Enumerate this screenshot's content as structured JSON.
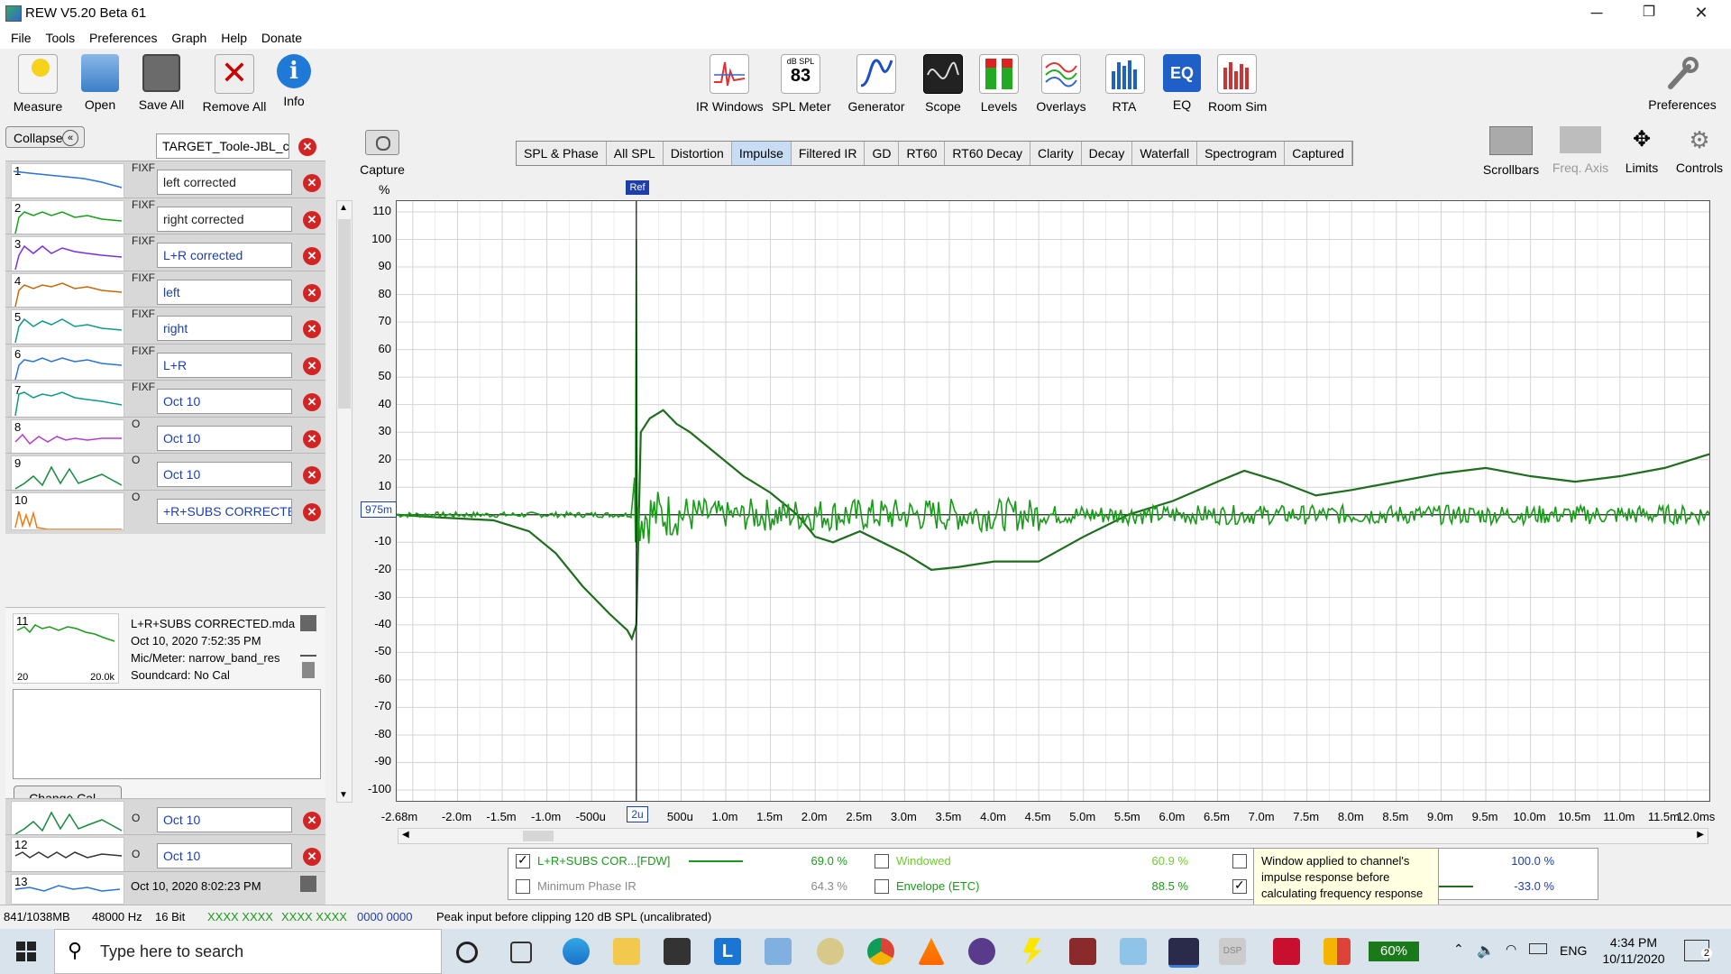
{
  "window": {
    "title": "REW V5.20 Beta 61",
    "min": "─",
    "max": "❐",
    "close": "✕"
  },
  "menu": [
    "File",
    "Tools",
    "Preferences",
    "Graph",
    "Help",
    "Donate"
  ],
  "toolbar_left": [
    {
      "label": "Measure",
      "icon": "microphone-icon"
    },
    {
      "label": "Open",
      "icon": "folder-icon"
    },
    {
      "label": "Save All",
      "icon": "save-icon"
    },
    {
      "label": "Remove All",
      "icon": "remove-icon"
    },
    {
      "label": "Info",
      "icon": "info-icon"
    }
  ],
  "toolbar_center": [
    {
      "label": "IR Windows",
      "icon": "ir-windows-icon"
    },
    {
      "label": "SPL Meter",
      "icon": "spl-meter-icon",
      "badge_top": "dB SPL",
      "badge_value": "83"
    },
    {
      "label": "Generator",
      "icon": "generator-icon"
    },
    {
      "label": "Scope",
      "icon": "scope-icon"
    },
    {
      "label": "Levels",
      "icon": "levels-icon"
    },
    {
      "label": "Overlays",
      "icon": "overlays-icon"
    },
    {
      "label": "RTA",
      "icon": "rta-icon"
    },
    {
      "label": "EQ",
      "icon": "eq-icon"
    },
    {
      "label": "Room Sim",
      "icon": "room-sim-icon"
    }
  ],
  "preferences_label": "Preferences",
  "right_controls": [
    "Scrollbars",
    "Freq. Axis",
    "Limits",
    "Controls"
  ],
  "capture_label": "Capture",
  "collapse_label": "Collapse",
  "top_measurement": "TARGET_Toole-JBL_cu",
  "measurements": [
    {
      "num": "1",
      "name": "left corrected",
      "fixf": "FIXF",
      "color": "#2a72d8"
    },
    {
      "num": "2",
      "name": "right corrected",
      "fixf": "FIXF",
      "color": "#11a11a"
    },
    {
      "num": "3",
      "name": "L+R corrected",
      "fixf": "FIXF",
      "color": "#7a2ee0"
    },
    {
      "num": "4",
      "name": "left",
      "fixf": "FIXF",
      "color": "#c26a0a"
    },
    {
      "num": "5",
      "name": "right",
      "fixf": "FIXF",
      "color": "#0d9a8a"
    },
    {
      "num": "6",
      "name": "L+R",
      "fixf": "FIXF",
      "color": "#2a72d8"
    },
    {
      "num": "7",
      "name": "Oct 10",
      "fixf": "FIXF",
      "color": "#0d9a8a"
    },
    {
      "num": "8",
      "name": "Oct 10",
      "fixf": "O",
      "color": "#b43ad0"
    },
    {
      "num": "9",
      "name": "Oct 10",
      "fixf": "O",
      "color": "#168a3a"
    },
    {
      "num": "10",
      "name": "+R+SUBS CORRECTED",
      "fixf": "O",
      "color": "#ef7a10"
    }
  ],
  "selected_info": {
    "num": "11",
    "file": "L+R+SUBS CORRECTED.mda",
    "date": "Oct 10, 2020 7:52:35 PM",
    "mic": "Mic/Meter: narrow_band_res",
    "soundcard": "Soundcard: No Cal",
    "f_low": "20",
    "f_high": "20.0k"
  },
  "change_cal": "Change Cal...",
  "measurements_below": [
    {
      "num": "",
      "name": "Oct 10",
      "fixf": "O",
      "color": "#168a3a"
    },
    {
      "num": "12",
      "name": "Oct 10",
      "fixf": "O",
      "color": "#333333"
    }
  ],
  "row13": {
    "num": "13",
    "date": "Oct 10, 2020 8:02:23 PM"
  },
  "tabs": [
    "SPL & Phase",
    "All SPL",
    "Distortion",
    "Impulse",
    "Filtered IR",
    "GD",
    "RT60",
    "RT60 Decay",
    "Clarity",
    "Decay",
    "Waterfall",
    "Spectrogram",
    "Captured"
  ],
  "active_tab": "Impulse",
  "cursor": {
    "marker": "Ref",
    "y_readout": "975m",
    "x_readout": "2u"
  },
  "chart_data": {
    "type": "line",
    "ylabel": "%",
    "ylim": [
      -100,
      110
    ],
    "yticks": [
      "110",
      "100",
      "90",
      "80",
      "70",
      "60",
      "50",
      "40",
      "30",
      "20",
      "10",
      "",
      "-10",
      "-20",
      "-30",
      "-40",
      "-50",
      "-60",
      "-70",
      "-80",
      "-90",
      "-100"
    ],
    "xlim": [
      -2.68,
      12.0
    ],
    "xticks": [
      "-2.68m",
      "-2.0m",
      "-1.5m",
      "-1.0m",
      "-500u",
      "",
      "500u",
      "1.0m",
      "1.5m",
      "2.0m",
      "2.5m",
      "3.0m",
      "3.5m",
      "4.0m",
      "4.5m",
      "5.0m",
      "5.5m",
      "6.0m",
      "6.5m",
      "7.0m",
      "7.5m",
      "8.0m",
      "8.5m",
      "9.0m",
      "9.5m",
      "10.0m",
      "10.5m",
      "11.0m",
      "11.5m",
      "12.0ms"
    ],
    "series": [
      {
        "name": "L+R+SUBS COR...[FDW]",
        "color": "#1a9a1a"
      },
      {
        "name": "Windowed",
        "color": "#1e6e1e"
      }
    ]
  },
  "legend": {
    "rows": [
      {
        "check": true,
        "name": "L+R+SUBS COR...[FDW]",
        "value": "69.0 %",
        "name2": "Windowed",
        "check2": false,
        "value2": "60.9 %",
        "value3": "100.0 %"
      },
      {
        "check": false,
        "name": "Minimum Phase IR",
        "value": "64.3 %",
        "name2": "Envelope (ETC)",
        "check2": false,
        "value2": "88.5 %",
        "value3": "-33.0 %"
      }
    ]
  },
  "tooltip": "Window applied to channel's impulse response before calculating frequency response",
  "status": {
    "memory": "841/1038MB",
    "rate": "48000 Hz",
    "bits": "16 Bit",
    "hex1": "XXXX XXXX",
    "hex2": "XXXX XXXX",
    "hex3": "0000 0000",
    "message": "Peak input before clipping 120 dB SPL (uncalibrated)"
  },
  "taskbar": {
    "search_placeholder": "Type here to search",
    "battery": "60%",
    "lang": "ENG",
    "time": "4:34 PM",
    "date": "10/11/2020",
    "notif": "2"
  }
}
